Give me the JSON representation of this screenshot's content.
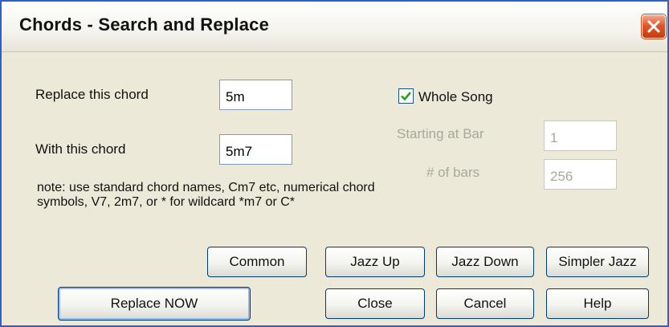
{
  "window": {
    "title": "Chords - Search and Replace",
    "close_icon": "close-x-icon",
    "close_color": "#d9501f"
  },
  "form": {
    "replace_label": "Replace this chord",
    "replace_value": "5m",
    "with_label": "With this chord",
    "with_value": "5m7",
    "note": "note: use standard chord names, Cm7 etc, numerical chord symbols, V7, 2m7, or * for wildcard *m7 or C*"
  },
  "range": {
    "whole_song_label": "Whole Song",
    "whole_song_checked": true,
    "starting_bar_label": "Starting at Bar",
    "starting_bar_value": "1",
    "num_bars_label": "# of bars",
    "num_bars_value": "256"
  },
  "presets": {
    "common": "Common",
    "jazz_up": "Jazz Up",
    "jazz_down": "Jazz Down",
    "simpler_jazz": "Simpler Jazz"
  },
  "actions": {
    "replace_now": "Replace NOW",
    "close": "Close",
    "cancel": "Cancel",
    "help": "Help"
  },
  "colors": {
    "titlebar_border": "#2e5fd1",
    "dialog_bg": "#ece9d8",
    "checkmark": "#21a121",
    "disabled_text": "#a9a89c"
  }
}
